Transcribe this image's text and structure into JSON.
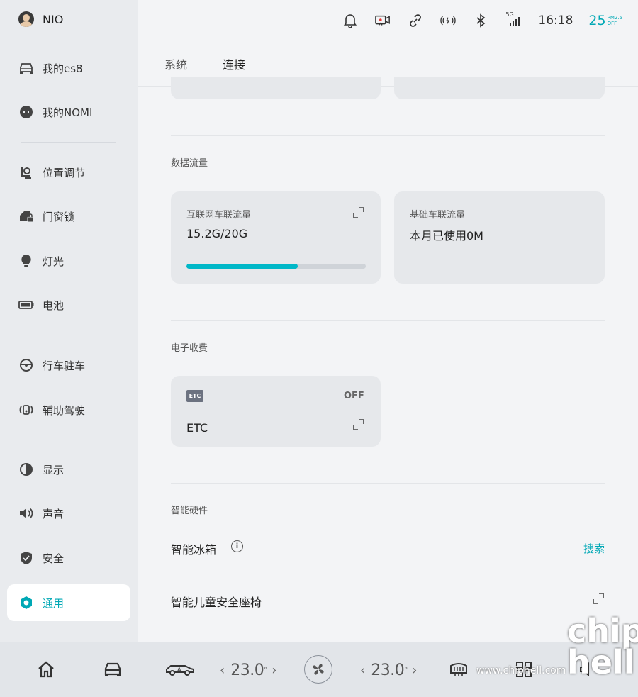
{
  "user": {
    "name": "NIO"
  },
  "sidebar": {
    "items": [
      {
        "label": "我的es8",
        "icon": "car-front-icon"
      },
      {
        "label": "我的NOMI",
        "icon": "nomi-face-icon"
      },
      {
        "label": "位置调节",
        "icon": "seat-adjust-icon"
      },
      {
        "label": "门窗锁",
        "icon": "door-lock-icon"
      },
      {
        "label": "灯光",
        "icon": "bulb-icon"
      },
      {
        "label": "电池",
        "icon": "battery-icon"
      },
      {
        "label": "行车驻车",
        "icon": "steering-wheel-icon"
      },
      {
        "label": "辅助驾驶",
        "icon": "assist-drive-icon"
      },
      {
        "label": "显示",
        "icon": "display-contrast-icon"
      },
      {
        "label": "声音",
        "icon": "speaker-icon"
      },
      {
        "label": "安全",
        "icon": "shield-icon"
      },
      {
        "label": "通用",
        "icon": "general-settings-icon"
      }
    ],
    "active": "通用"
  },
  "status_bar": {
    "time": "16:18",
    "network": "5G",
    "pm_value": "25",
    "pm_label": "PM2.5",
    "pm_state": "OFF"
  },
  "tabs": [
    {
      "label": "系统"
    },
    {
      "label": "连接"
    }
  ],
  "data_usage": {
    "title": "数据流量",
    "internet": {
      "label": "互联网车联流量",
      "value": "15.2G/20G",
      "used_fraction": 0.62
    },
    "basic": {
      "label": "基础车联流量",
      "value": "本月已使用0M"
    }
  },
  "etc": {
    "title": "电子收费",
    "badge": "ETC",
    "state": "OFF",
    "label": "ETC"
  },
  "hardware": {
    "title": "智能硬件",
    "fridge": {
      "label": "智能冰箱",
      "action": "搜索"
    },
    "child_seat": {
      "label": "智能儿童安全座椅"
    }
  },
  "bottom_bar": {
    "left_temp": "23.0",
    "right_temp": "23.0"
  },
  "watermark": {
    "url": "www.chiphell.com",
    "logo": "chip hell"
  },
  "colors": {
    "accent": "#00a8b5",
    "progress": "#00b8c8"
  }
}
